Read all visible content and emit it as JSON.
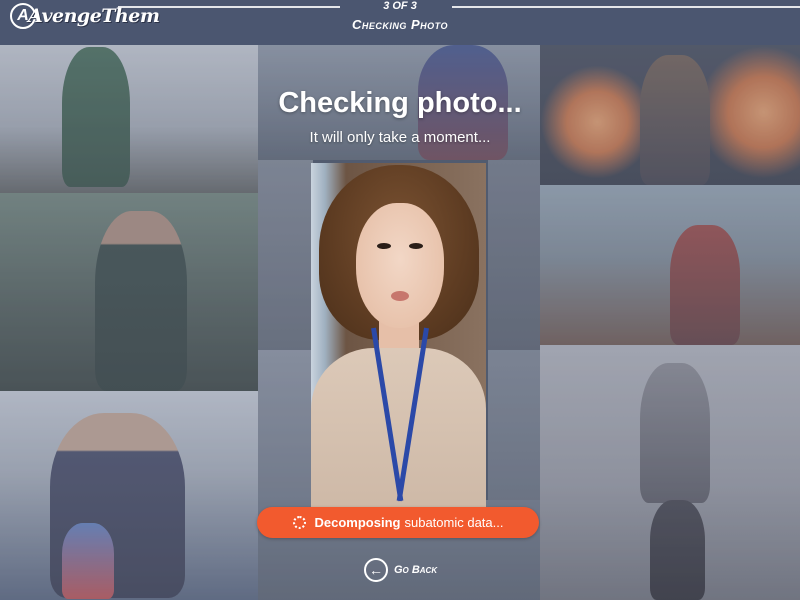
{
  "header": {
    "logo_text": "AvengeThem",
    "logo_mark": "A",
    "step_count": "3 OF 3",
    "step_name": "Checking Photo"
  },
  "main": {
    "title": "Checking photo...",
    "subtitle": "It will only take a moment..."
  },
  "status": {
    "strong_text": "Decomposing",
    "rest_text": "subatomic data...",
    "icon": "spinner-icon",
    "color": "#f25a2e"
  },
  "navigation": {
    "go_back_label": "Go Back",
    "icon": "arrow-left-icon"
  }
}
